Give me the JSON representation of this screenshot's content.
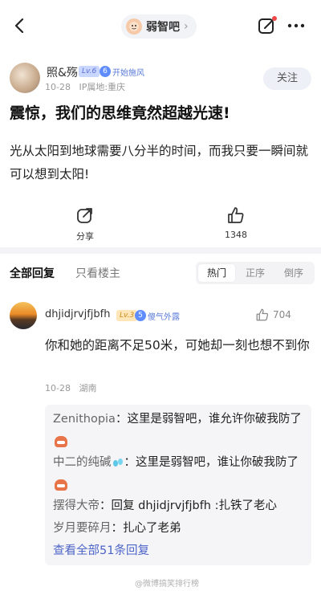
{
  "header": {
    "forum_name": "弱智吧",
    "forum_chevron": "›"
  },
  "author": {
    "name": "照&殇",
    "level": "Lv.6",
    "tag": "开始施风",
    "date": "10-28",
    "location": "IP属地:重庆",
    "follow_label": "关注"
  },
  "post": {
    "title": "震惊，我们的思维竟然超越光速!",
    "body": "光从太阳到地球需要八分半的时间，而我只要一瞬间就可以想到太阳!"
  },
  "actions": {
    "share_label": "分享",
    "like_count": "1348"
  },
  "tabs": {
    "all": "全部回复",
    "owner_only": "只看楼主"
  },
  "sort": {
    "options": [
      "热门",
      "正序",
      "倒序"
    ],
    "active": "热门"
  },
  "comment": {
    "user": "dhjidjrvjfjbfh",
    "level": "Lv.3",
    "tag": "傻气外露",
    "likes": "704",
    "text": "你和她的距离不足50米，可她却一刻也想不到你",
    "date": "10-28",
    "location": "湖南"
  },
  "replies": [
    {
      "name": "Zenithopia",
      "sep": "：",
      "text": "这里是弱智吧，谁允许你破我防了"
    },
    {
      "name": "中二的纯碱",
      "sep": "：",
      "text": "这里是弱智吧，谁让你破我防了"
    },
    {
      "name": "摆得大帝",
      "sep": "：",
      "text": "回复 dhjidjrvjfjbfh :扎铁了老心"
    },
    {
      "name": "岁月要碎月",
      "sep": "：",
      "text": "扎心了老弟"
    }
  ],
  "view_all_label": "查看全部51条回复",
  "watermark": "@微博搞笑排行榜",
  "icons": {
    "back": "back-arrow-icon",
    "edit": "edit-icon",
    "more": "more-dots-icon",
    "share": "share-icon",
    "like": "thumbs-up-icon"
  },
  "colors": {
    "link": "#4d64c8",
    "level_badge": "#c9d6ff",
    "tag_blue": "#5f8dff"
  }
}
